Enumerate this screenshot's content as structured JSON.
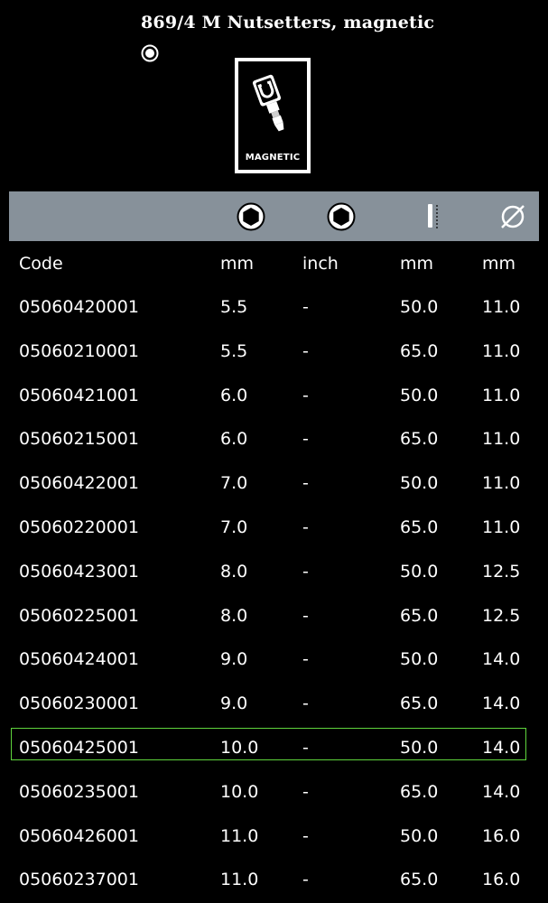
{
  "product": {
    "title": "869/4 M Nutsetters, magnetic",
    "badge_label": "MAGNETIC",
    "badge_icon": "magnetic-nutsetter-icon",
    "radio_icon": "radio-selected-icon"
  },
  "icon_bar": {
    "icons": [
      "hex-socket-mm-icon",
      "hex-socket-inch-icon",
      "length-icon",
      "diameter-icon"
    ],
    "background": "#87919a"
  },
  "table": {
    "headers": [
      "Code",
      "mm",
      "inch",
      "mm",
      "mm"
    ],
    "rows": [
      [
        "05060420001",
        "5.5",
        "-",
        "50.0",
        "11.0"
      ],
      [
        "05060210001",
        "5.5",
        "-",
        "65.0",
        "11.0"
      ],
      [
        "05060421001",
        "6.0",
        "-",
        "50.0",
        "11.0"
      ],
      [
        "05060215001",
        "6.0",
        "-",
        "65.0",
        "11.0"
      ],
      [
        "05060422001",
        "7.0",
        "-",
        "50.0",
        "11.0"
      ],
      [
        "05060220001",
        "7.0",
        "-",
        "65.0",
        "11.0"
      ],
      [
        "05060423001",
        "8.0",
        "-",
        "50.0",
        "12.5"
      ],
      [
        "05060225001",
        "8.0",
        "-",
        "65.0",
        "12.5"
      ],
      [
        "05060424001",
        "9.0",
        "-",
        "50.0",
        "14.0"
      ],
      [
        "05060230001",
        "9.0",
        "-",
        "65.0",
        "14.0"
      ],
      [
        "05060425001",
        "10.0",
        "-",
        "50.0",
        "14.0"
      ],
      [
        "05060235001",
        "10.0",
        "-",
        "65.0",
        "14.0"
      ],
      [
        "05060426001",
        "11.0",
        "-",
        "50.0",
        "16.0"
      ],
      [
        "05060237001",
        "11.0",
        "-",
        "65.0",
        "16.0"
      ]
    ],
    "selected_code": "05060425001",
    "selection_color": "#5fd43c"
  }
}
